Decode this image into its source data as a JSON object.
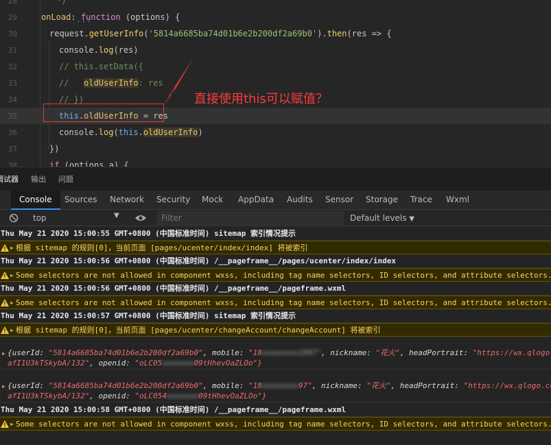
{
  "editor": {
    "lines": [
      {
        "n": "28",
        "segments": [
          {
            "c": "cm",
            "t": " */"
          }
        ]
      },
      {
        "n": "29",
        "segments": [
          {
            "c": "fn",
            "t": "onLoad"
          },
          {
            "c": "plain",
            "t": ": "
          },
          {
            "c": "kw",
            "t": "function"
          },
          {
            "c": "plain",
            "t": " (options) {"
          }
        ]
      },
      {
        "n": "30",
        "segments": [
          {
            "c": "plain",
            "t": "request."
          },
          {
            "c": "fn2",
            "t": "getUserInfo"
          },
          {
            "c": "plain",
            "t": "("
          },
          {
            "c": "str",
            "t": "'5814a6685ba74d01b6e2b200df2a69b0'"
          },
          {
            "c": "plain",
            "t": ")."
          },
          {
            "c": "fn2",
            "t": "then"
          },
          {
            "c": "plain",
            "t": "(res => {"
          }
        ]
      },
      {
        "n": "31",
        "segments": [
          {
            "c": "plain",
            "t": "console."
          },
          {
            "c": "fn2",
            "t": "log"
          },
          {
            "c": "plain",
            "t": "(res)"
          }
        ]
      },
      {
        "n": "32",
        "segments": [
          {
            "c": "cm",
            "t": "// this.setData({"
          }
        ]
      },
      {
        "n": "33",
        "segments": [
          {
            "c": "cm",
            "t": "//   "
          },
          {
            "c": "prop",
            "t": "oldUserInfo"
          },
          {
            "c": "cm",
            "t": ": res"
          }
        ]
      },
      {
        "n": "34",
        "segments": [
          {
            "c": "cm",
            "t": "// })"
          }
        ]
      },
      {
        "n": "35",
        "segments": [
          {
            "c": "thiskw",
            "t": "this"
          },
          {
            "c": "plain",
            "t": "."
          },
          {
            "c": "prop",
            "t": "oldUserInfo"
          },
          {
            "c": "plain",
            "t": " = res"
          }
        ]
      },
      {
        "n": "36",
        "segments": [
          {
            "c": "plain",
            "t": "console."
          },
          {
            "c": "fn2",
            "t": "log"
          },
          {
            "c": "plain",
            "t": "("
          },
          {
            "c": "thiskw",
            "t": "this"
          },
          {
            "c": "plain",
            "t": "."
          },
          {
            "c": "prop",
            "t": "oldUserInfo"
          },
          {
            "c": "plain",
            "t": ")"
          }
        ]
      },
      {
        "n": "37",
        "segments": [
          {
            "c": "plain",
            "t": "})"
          }
        ]
      },
      {
        "n": "38",
        "segments": [
          {
            "c": "kw",
            "t": "if"
          },
          {
            "c": "plain",
            "t": " (options.a) {"
          }
        ]
      }
    ],
    "fold_dots": "...",
    "annotation": "直接使用this可以赋值？"
  },
  "panel_tabs": [
    "调试器",
    "输出",
    "问题"
  ],
  "devtools_tabs": [
    "Console",
    "Sources",
    "Network",
    "Security",
    "Mock",
    "AppData",
    "Audits",
    "Sensor",
    "Storage",
    "Trace",
    "Wxml"
  ],
  "toolbar": {
    "context": "top",
    "filter_placeholder": "Filter",
    "levels": "Default levels"
  },
  "console": {
    "messages": [
      {
        "type": "info",
        "text": "Thu May 21 2020 15:00:55 GMT+0800 (中国标准时间) sitemap 索引情况提示"
      },
      {
        "type": "warn",
        "text": "根据 sitemap 的规则[0]，当前页面 [pages/ucenter/index/index] 将被索引"
      },
      {
        "type": "info",
        "text": "Thu May 21 2020 15:00:56 GMT+0800 (中国标准时间) /__pageframe__/pages/ucenter/index/index"
      },
      {
        "type": "warn",
        "text": "Some selectors are not allowed in component wxss, including tag name selectors, ID selectors, and attribute selectors.(."
      },
      {
        "type": "info",
        "text": "Thu May 21 2020 15:00:56 GMT+0800 (中国标准时间) /__pageframe__/pageframe.wxml"
      },
      {
        "type": "warn",
        "text": "Some selectors are not allowed in component wxss, including tag name selectors, ID selectors, and attribute selectors.(."
      },
      {
        "type": "info",
        "text": "Thu May 21 2020 15:00:57 GMT+0800 (中国标准时间) sitemap 索引情况提示"
      },
      {
        "type": "warn",
        "text": "根据 sitemap 的规则[0]，当前页面 [pages/ucenter/changeAccount/changeAccount] 将被索引"
      },
      {
        "type": "obj",
        "userId": "\"5814a6685ba74d01b6e2b200df2a69b0\"",
        "mobile_a": "\"18",
        "mobile_b": "xxxxxxxx1997\"",
        "nickname": "\"花火\"",
        "headPortrait": "\"https://wx.qlogo.cn/",
        "line2a": "afI1U3kTSkybA/132\"",
        "openid_a": "\"oLC05",
        "openid_b": "xxxxxxx",
        "openid_c": "09tHhevOaZLOo\"}"
      },
      {
        "type": "obj",
        "userId": "\"5814a6685ba74d01b6e2b200df2a69b0\"",
        "mobile_a": "\"18",
        "mobile_b": "xxxxxxxx",
        "mobile_c": "97\"",
        "nickname": "\"花火\"",
        "headPortrait": "\"https://wx.qlogo.cn/",
        "line2a": "afI1U3kTSkybA/132\"",
        "openid_a": "\"oLC054",
        "openid_b": "xxxxxxx",
        "openid_c": "09tHhevOaZLOo\"}"
      },
      {
        "type": "info",
        "text": "Thu May 21 2020 15:00:58 GMT+0800 (中国标准时间) /__pageframe__/pageframe.wxml"
      },
      {
        "type": "warn",
        "text": "Some selectors are not allowed in component wxss, including tag name selectors, ID selectors, and attribute selectors.(."
      }
    ]
  }
}
